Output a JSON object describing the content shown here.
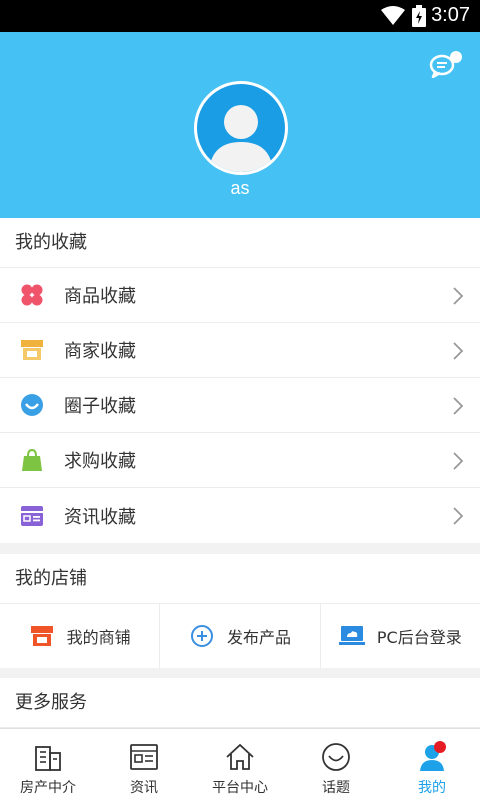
{
  "status_bar": {
    "time": "3:07"
  },
  "profile": {
    "username": "as"
  },
  "favorites": {
    "title": "我的收藏",
    "items": [
      {
        "label": "商品收藏",
        "icon": "clover-icon",
        "color": "#f0546b"
      },
      {
        "label": "商家收藏",
        "icon": "storefront-icon",
        "color": "#f0b23c"
      },
      {
        "label": "圈子收藏",
        "icon": "smile-circle-icon",
        "color": "#3aa0e6"
      },
      {
        "label": "求购收藏",
        "icon": "shopping-bag-icon",
        "color": "#7cc442"
      },
      {
        "label": "资讯收藏",
        "icon": "card-icon",
        "color": "#8a62d8"
      }
    ]
  },
  "shop": {
    "title": "我的店铺",
    "items": [
      {
        "label": "我的商铺",
        "icon": "store-icon",
        "color": "#f0552a"
      },
      {
        "label": "发布产品",
        "icon": "plus-circle-icon",
        "color": "#3a8fe0"
      },
      {
        "label": "PC后台登录",
        "icon": "monitor-icon",
        "color": "#2a8be0"
      }
    ]
  },
  "more": {
    "title": "更多服务"
  },
  "tabs": [
    {
      "label": "房产中介",
      "icon": "building-icon"
    },
    {
      "label": "资讯",
      "icon": "news-icon"
    },
    {
      "label": "平台中心",
      "icon": "home-icon"
    },
    {
      "label": "话题",
      "icon": "smile-icon"
    },
    {
      "label": "我的",
      "icon": "user-icon",
      "active": true
    }
  ],
  "colors": {
    "header": "#45c1f3",
    "accent": "#1da1e8",
    "badge": "#e51c23"
  }
}
